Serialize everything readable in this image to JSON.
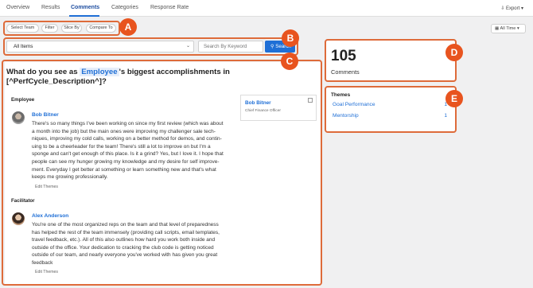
{
  "nav": {
    "tabs": [
      "Overview",
      "Results",
      "Comments",
      "Categories",
      "Response Rate"
    ],
    "export": "Export ▾"
  },
  "filters": {
    "chips": [
      "Select Team",
      "Filter",
      "Slice By",
      "Compare To"
    ],
    "time": "All Time ▾"
  },
  "search": {
    "select_value": "All Items",
    "keyword_placeholder": "Search By Keyword",
    "button": "Search"
  },
  "question": {
    "prefix": "What do you see as ",
    "highlight": "Employee",
    "suffix": "'s biggest accomplishments in [^PerfCycle_Description^]?"
  },
  "employee_section": {
    "title": "Employee",
    "name": "Bob Bitner",
    "lines": [
      "There's so many things I've been working on since my first review (which was about",
      "a month into the job) but the main ones were improving my challenger sale tech-",
      "niques, improving my cold calls, working on a better method for demos, and contin-",
      "uing to be a cheerleader for the team! There's still a lot to improve on but I'm a",
      "sponge and can't get enough of this place. Is it a grind? Yes, but I love it. I hope that",
      "people can see my hunger growing my knowledge and my desire for self improve-",
      "ment. Everyday I get better at something or learn something new and that's what",
      "keeps me growing professionally."
    ],
    "edit": "Edit Themes"
  },
  "facilitator_section": {
    "title": "Facilitator",
    "name": "Alex Anderson",
    "lines": [
      "You're one of the most organized reps on the team and that level of preparedness",
      "has helped the rest of the team immensely (providing call scripts, email templates,",
      "travel feedback, etc.). All of this also outlines how hard you work both inside and",
      "outside of the office. Your dedication to cracking the club code is getting noticed",
      "outside of our team, and nearly everyone you've worked with has given you great",
      "feedback"
    ],
    "edit": "Edit Themes"
  },
  "employee_card": {
    "name": "Bob Bitner",
    "role": "Chief Finance Officer"
  },
  "stats": {
    "count": "105",
    "label": "Comments"
  },
  "themes": {
    "title": "Themes",
    "items": [
      {
        "label": "Goal Performance",
        "count": "1"
      },
      {
        "label": "Mentorship",
        "count": "1"
      }
    ]
  },
  "badges": [
    "A",
    "B",
    "C",
    "D",
    "E"
  ],
  "colors": {
    "accent": "#1f6fd6",
    "annotation": "#e8541f"
  }
}
